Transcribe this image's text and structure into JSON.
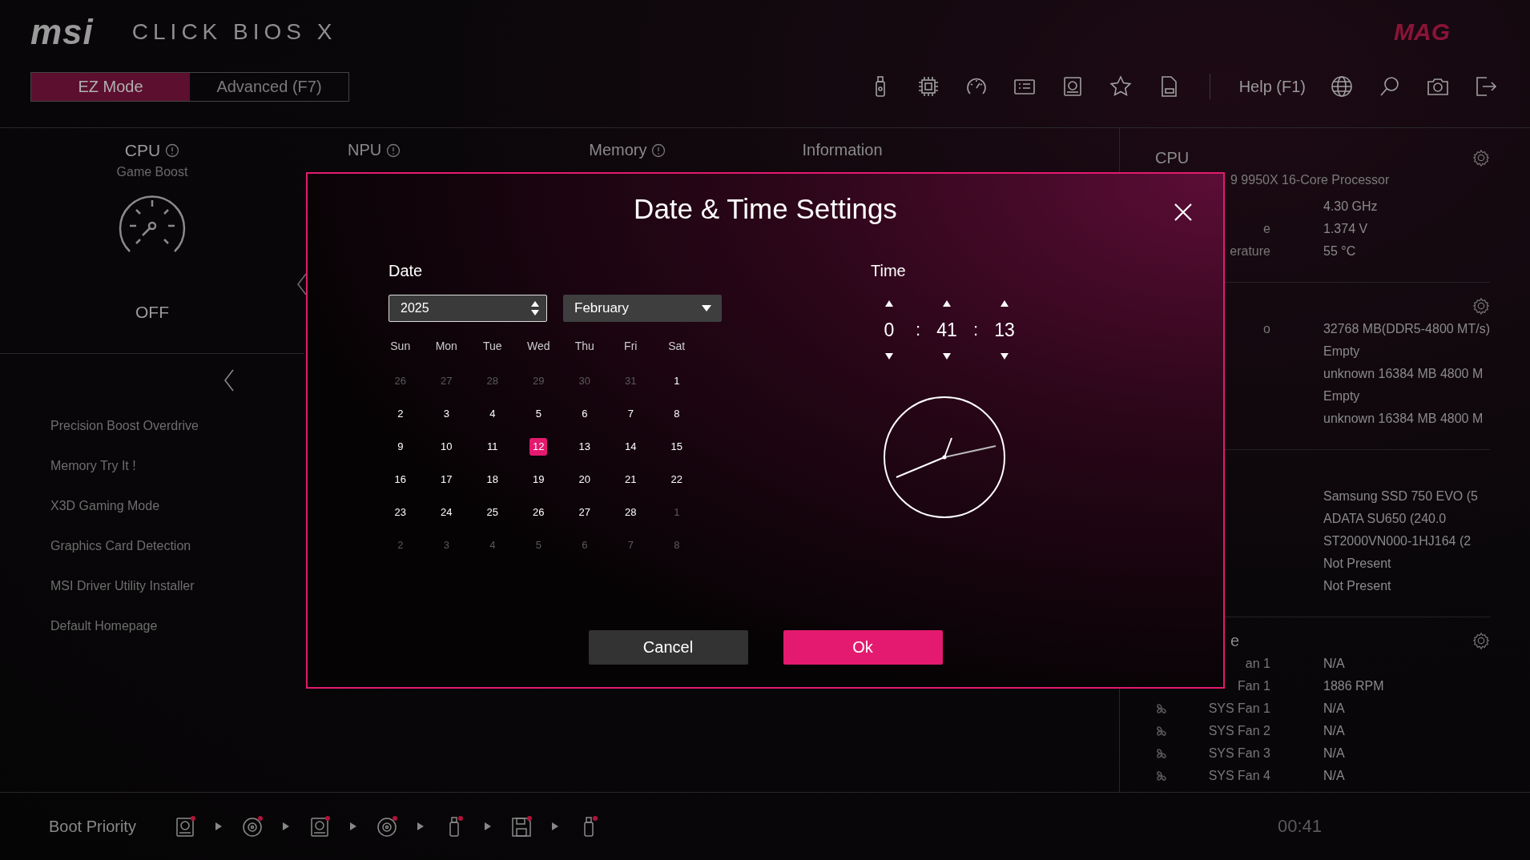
{
  "header": {
    "logo": "msi",
    "product": "CLICK BIOS X",
    "brand": "MAG",
    "modes": [
      {
        "label": "EZ Mode",
        "selected": true
      },
      {
        "label": "Advanced (F7)",
        "selected": false
      }
    ],
    "help": "Help (F1)"
  },
  "left_panel": {
    "title": "CPU",
    "subtitle": "Game Boost",
    "state": "OFF",
    "items": [
      "Precision Boost Overdrive",
      "Memory Try It !",
      "X3D Gaming Mode",
      "Graphics Card Detection",
      "MSI Driver Utility Installer",
      "Default Homepage"
    ]
  },
  "columns": [
    {
      "title": "NPU",
      "info": true
    },
    {
      "title": "Memory",
      "info": true
    },
    {
      "title": "Information"
    }
  ],
  "right_panel": {
    "sections": [
      {
        "title": "CPU",
        "subtitle": "9 9950X 16-Core Processor",
        "gear": true,
        "rows": [
          {
            "label": "",
            "value": "4.30 GHz",
            "kind": "plain"
          },
          {
            "label": "e",
            "value": "1.374 V",
            "kind": "plain"
          },
          {
            "label": "erature",
            "value": "55 °C",
            "kind": "plain"
          }
        ]
      },
      {
        "gear": true,
        "rows": [
          {
            "label": "o",
            "value": "32768 MB(DDR5-4800 MT/s)",
            "kind": "plain"
          },
          {
            "label": "",
            "value": "Empty",
            "kind": "plain"
          },
          {
            "label": "",
            "value": "unknown 16384 MB 4800 M",
            "kind": "plain"
          },
          {
            "label": "",
            "value": "Empty",
            "kind": "plain"
          },
          {
            "label": "",
            "value": "unknown 16384 MB 4800 M",
            "kind": "plain"
          }
        ]
      },
      {
        "rows": [
          {
            "label": "",
            "value": "Samsung SSD 750 EVO (5",
            "kind": "plain"
          },
          {
            "label": "",
            "value": "ADATA SU650 (240.0",
            "kind": "plain"
          },
          {
            "label": "",
            "value": "ST2000VN000-1HJ164 (2",
            "kind": "plain"
          },
          {
            "label": "",
            "value": "Not Present",
            "kind": "plain"
          },
          {
            "label": "",
            "value": "Not Present",
            "kind": "plain"
          }
        ]
      },
      {
        "title": "e",
        "gear": true,
        "rows": [
          {
            "label": "an 1",
            "value": "N/A",
            "kind": "plain"
          },
          {
            "label": "Fan 1",
            "value": "1886 RPM",
            "kind": "plain"
          },
          {
            "label": "SYS Fan 1",
            "value": "N/A",
            "kind": "fan"
          },
          {
            "label": "SYS Fan 2",
            "value": "N/A",
            "kind": "fan"
          },
          {
            "label": "SYS Fan 3",
            "value": "N/A",
            "kind": "fan"
          },
          {
            "label": "SYS Fan 4",
            "value": "N/A",
            "kind": "fan"
          }
        ]
      }
    ]
  },
  "footer": {
    "label": "Boot Priority",
    "devices": [
      {
        "kind": "hdd"
      },
      {
        "kind": "disc"
      },
      {
        "kind": "hdd"
      },
      {
        "kind": "disc"
      },
      {
        "kind": "usb"
      },
      {
        "kind": "floppy"
      },
      {
        "kind": "usb"
      }
    ],
    "time": "00:41"
  },
  "dialog": {
    "title": "Date & Time Settings",
    "date_label": "Date",
    "year": "2025",
    "month": "February",
    "weekdays": [
      "Sun",
      "Mon",
      "Tue",
      "Wed",
      "Thu",
      "Fri",
      "Sat"
    ],
    "weeks": [
      [
        {
          "day": "26",
          "muted": true,
          "selected": false
        },
        {
          "day": "27",
          "muted": true,
          "selected": false
        },
        {
          "day": "28",
          "muted": true,
          "selected": false
        },
        {
          "day": "29",
          "muted": true,
          "selected": false
        },
        {
          "day": "30",
          "muted": true,
          "selected": false
        },
        {
          "day": "31",
          "muted": true,
          "selected": false
        },
        {
          "day": "1",
          "muted": false,
          "selected": false
        }
      ],
      [
        {
          "day": "2",
          "muted": false,
          "selected": false
        },
        {
          "day": "3",
          "muted": false,
          "selected": false
        },
        {
          "day": "4",
          "muted": false,
          "selected": false
        },
        {
          "day": "5",
          "muted": false,
          "selected": false
        },
        {
          "day": "6",
          "muted": false,
          "selected": false
        },
        {
          "day": "7",
          "muted": false,
          "selected": false
        },
        {
          "day": "8",
          "muted": false,
          "selected": false
        }
      ],
      [
        {
          "day": "9",
          "muted": false,
          "selected": false
        },
        {
          "day": "10",
          "muted": false,
          "selected": false
        },
        {
          "day": "11",
          "muted": false,
          "selected": false
        },
        {
          "day": "12",
          "muted": false,
          "selected": true
        },
        {
          "day": "13",
          "muted": false,
          "selected": false
        },
        {
          "day": "14",
          "muted": false,
          "selected": false
        },
        {
          "day": "15",
          "muted": false,
          "selected": false
        }
      ],
      [
        {
          "day": "16",
          "muted": false,
          "selected": false
        },
        {
          "day": "17",
          "muted": false,
          "selected": false
        },
        {
          "day": "18",
          "muted": false,
          "selected": false
        },
        {
          "day": "19",
          "muted": false,
          "selected": false
        },
        {
          "day": "20",
          "muted": false,
          "selected": false
        },
        {
          "day": "21",
          "muted": false,
          "selected": false
        },
        {
          "day": "22",
          "muted": false,
          "selected": false
        }
      ],
      [
        {
          "day": "23",
          "muted": false,
          "selected": false
        },
        {
          "day": "24",
          "muted": false,
          "selected": false
        },
        {
          "day": "25",
          "muted": false,
          "selected": false
        },
        {
          "day": "26",
          "muted": false,
          "selected": false
        },
        {
          "day": "27",
          "muted": false,
          "selected": false
        },
        {
          "day": "28",
          "muted": false,
          "selected": false
        },
        {
          "day": "1",
          "muted": true,
          "selected": false
        }
      ],
      [
        {
          "day": "2",
          "muted": true,
          "selected": false
        },
        {
          "day": "3",
          "muted": true,
          "selected": false
        },
        {
          "day": "4",
          "muted": true,
          "selected": false
        },
        {
          "day": "5",
          "muted": true,
          "selected": false
        },
        {
          "day": "6",
          "muted": true,
          "selected": false
        },
        {
          "day": "7",
          "muted": true,
          "selected": false
        },
        {
          "day": "8",
          "muted": true,
          "selected": false
        }
      ]
    ],
    "time_label": "Time",
    "time": [
      "0",
      "41",
      "13"
    ],
    "separator": ":",
    "buttons": [
      {
        "label": "Cancel",
        "kind": "secondary"
      },
      {
        "label": "Ok",
        "kind": "primary"
      }
    ]
  }
}
